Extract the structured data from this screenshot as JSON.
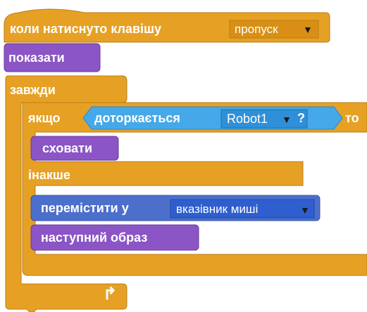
{
  "blocks": {
    "hat": {
      "label": "коли натиснуто клавішу",
      "key_value": "пропуск",
      "dropdown_arrow": "▼",
      "color": "#e6a125"
    },
    "show": {
      "label": "показати",
      "color": "#8b55c5"
    },
    "forever": {
      "label": "завжди",
      "color": "#e6a125",
      "loop_arrow": "↱"
    },
    "if_else": {
      "if_label": "якщо",
      "then_label": "то",
      "else_label": "інакше",
      "color": "#e6a125"
    },
    "touching": {
      "label": "доторкається",
      "value": "Robot1",
      "dropdown_arrow": "▼",
      "question": "?",
      "color": "#45a8e8"
    },
    "hide": {
      "label": "сховати",
      "color": "#8b55c5"
    },
    "goto": {
      "label": "перемістити у",
      "value": "вказівник миші",
      "dropdown_arrow": "▼",
      "color": "#4b6fcb"
    },
    "next_costume": {
      "label": "наступний образ",
      "color": "#8b55c5"
    }
  }
}
